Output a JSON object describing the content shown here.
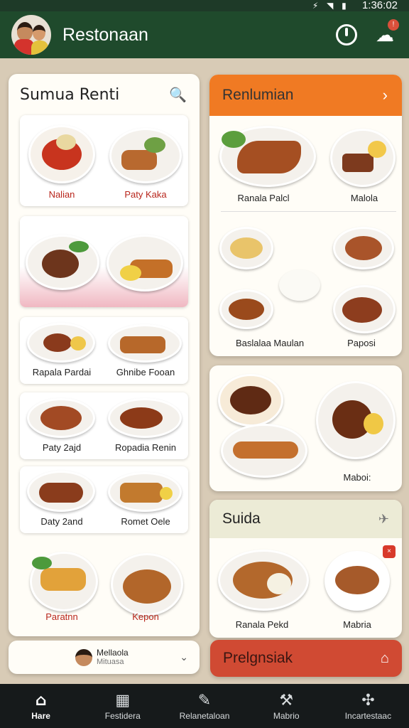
{
  "status": {
    "time": "1:36:02",
    "glyphs": "⚡ ◥ ▮"
  },
  "app": {
    "title": "Restonaan"
  },
  "left_card": {
    "title": "Sumua Renti",
    "search_icon": "search-icon",
    "tiles": [
      {
        "left": "Nalian",
        "right": "Paty Kaka"
      },
      {
        "left": "",
        "right": ""
      },
      {
        "left": "Rapala Pardai",
        "right": "Ghnibe Fooan"
      },
      {
        "left": "Paty 2ajd",
        "right": "Ropadia Renin"
      },
      {
        "left": "Daty 2and",
        "right": "Romet Oele"
      },
      {
        "left": "Paratnn",
        "right": "Kepon"
      }
    ]
  },
  "orange_card": {
    "title": "Renlumian",
    "chevron": "›",
    "row1": {
      "left": "Ranala Palcl",
      "right": "Malola"
    },
    "row2": {
      "left": "Baslalaa Maulan",
      "right": "Paposi"
    }
  },
  "middle_card": {
    "label": "Maboi:"
  },
  "suida_card": {
    "title": "Suida",
    "badge": "×",
    "left": "Ranala Pekd",
    "right": "Mabria"
  },
  "bottom_left": {
    "name": "Mellaola",
    "sub": "Mituasa"
  },
  "red_button": {
    "label": "Prelgnsiak"
  },
  "nav": [
    {
      "label": "Hare",
      "icon": "⌂",
      "active": true
    },
    {
      "label": "Festidera",
      "icon": "▦",
      "active": false
    },
    {
      "label": "Relanetaloan",
      "icon": "✎",
      "active": false
    },
    {
      "label": "Mabrio",
      "icon": "⚒",
      "active": false
    },
    {
      "label": "Incartestaac",
      "icon": "✣",
      "active": false
    }
  ],
  "colors": {
    "appbar": "#1f4a2c",
    "orange": "#f07a23",
    "red": "#d04a33",
    "navbar": "#161a1b"
  }
}
